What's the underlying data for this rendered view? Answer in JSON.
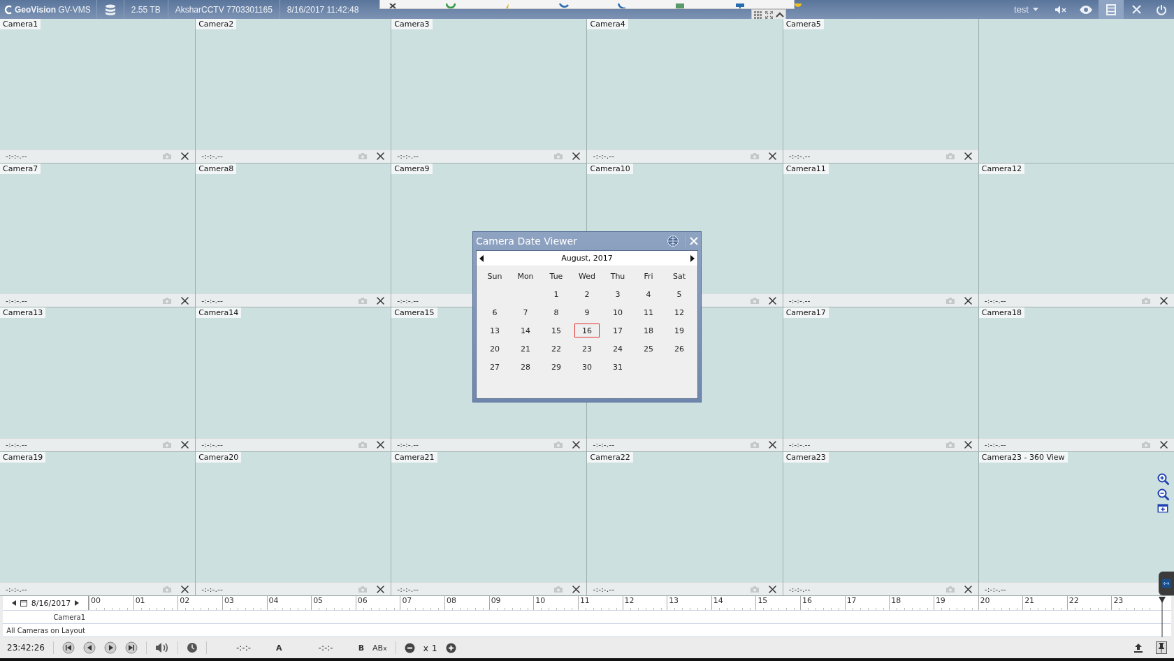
{
  "top_bar": {
    "logo": "GeoVision",
    "product": "GV-VMS",
    "storage": "2.55 TB",
    "server": "AksharCCTV 7703301165",
    "datetime": "8/16/2017 11:42:48",
    "user": "test"
  },
  "cells": [
    {
      "kind": "camera",
      "label": "Camera1",
      "time": "-:-:-.--"
    },
    {
      "kind": "camera",
      "label": "Camera2",
      "time": "-:-:-.--"
    },
    {
      "kind": "camera",
      "label": "Camera3",
      "time": "-:-:-.--"
    },
    {
      "kind": "camera",
      "label": "Camera4",
      "time": "-:-:-.--"
    },
    {
      "kind": "camera",
      "label": "Camera5",
      "time": "-:-:-.--"
    },
    {
      "kind": "empty"
    },
    {
      "kind": "camera",
      "label": "Camera7",
      "time": "-:-:-.--"
    },
    {
      "kind": "camera",
      "label": "Camera8",
      "time": "-:-:-.--"
    },
    {
      "kind": "covered",
      "label": "Camera9",
      "time": "-:-:-.--"
    },
    {
      "kind": "camera",
      "label": "Camera10"
    },
    {
      "kind": "camera",
      "label": "Camera11",
      "time": "-:-:-.--"
    },
    {
      "kind": "camera",
      "label": "Camera12",
      "time": "-:-:-.--"
    },
    {
      "kind": "camera",
      "label": "Camera13",
      "time": "-:-:-.--"
    },
    {
      "kind": "camera",
      "label": "Camera14",
      "time": "-:-:-.--"
    },
    {
      "kind": "camera",
      "label": "Camera15",
      "time": "-:-:-.--"
    },
    {
      "kind": "camera",
      "time": "-:-:-.--"
    },
    {
      "kind": "camera",
      "label": "Camera17",
      "time": "-:-:-.--"
    },
    {
      "kind": "camera",
      "label": "Camera18",
      "time": "-:-:-.--"
    },
    {
      "kind": "camera",
      "label": "Camera19",
      "time": "-:-:-.--"
    },
    {
      "kind": "camera",
      "label": "Camera20",
      "time": "-:-:-.--"
    },
    {
      "kind": "camera",
      "label": "Camera21",
      "time": "-:-:-.--"
    },
    {
      "kind": "camera",
      "label": "Camera22",
      "time": "-:-:-.--"
    },
    {
      "kind": "camera",
      "label": "Camera23",
      "time": "-:-:-.--"
    },
    {
      "kind": "panorama",
      "label": "Camera23 - 360 View",
      "time": "-:-:-.--"
    }
  ],
  "dialog": {
    "title": "Camera Date Viewer",
    "month": "August, 2017",
    "weekdays": [
      "Sun",
      "Mon",
      "Tue",
      "Wed",
      "Thu",
      "Fri",
      "Sat"
    ],
    "weeks": [
      [
        {
          "kind": "blank"
        },
        {
          "kind": "blank"
        },
        {
          "day": "1",
          "selected": false
        },
        {
          "day": "2",
          "selected": false
        },
        {
          "day": "3",
          "selected": false
        },
        {
          "day": "4",
          "selected": false
        },
        {
          "day": "5",
          "selected": false
        }
      ],
      [
        {
          "day": "6",
          "selected": false
        },
        {
          "day": "7",
          "selected": false
        },
        {
          "day": "8",
          "selected": false
        },
        {
          "day": "9",
          "selected": false
        },
        {
          "day": "10",
          "selected": false
        },
        {
          "day": "11",
          "selected": false
        },
        {
          "day": "12",
          "selected": false
        }
      ],
      [
        {
          "day": "13",
          "selected": false
        },
        {
          "day": "14",
          "selected": false
        },
        {
          "day": "15",
          "selected": false
        },
        {
          "day": "16",
          "selected": true
        },
        {
          "day": "17",
          "selected": false
        },
        {
          "day": "18",
          "selected": false
        },
        {
          "day": "19",
          "selected": false
        }
      ],
      [
        {
          "day": "20",
          "selected": false
        },
        {
          "day": "21",
          "selected": false
        },
        {
          "day": "22",
          "selected": false
        },
        {
          "day": "23",
          "selected": false
        },
        {
          "day": "24",
          "selected": false
        },
        {
          "day": "25",
          "selected": false
        },
        {
          "day": "26",
          "selected": false
        }
      ],
      [
        {
          "day": "27",
          "selected": false
        },
        {
          "day": "28",
          "selected": false
        },
        {
          "day": "29",
          "selected": false
        },
        {
          "day": "30",
          "selected": false
        },
        {
          "day": "31",
          "selected": false
        }
      ]
    ]
  },
  "timeline": {
    "date": "8/16/2017",
    "hours": [
      "00",
      "01",
      "02",
      "03",
      "04",
      "05",
      "06",
      "07",
      "08",
      "09",
      "10",
      "11",
      "12",
      "13",
      "14",
      "15",
      "16",
      "17",
      "18",
      "19",
      "20",
      "21",
      "22",
      "23"
    ],
    "rows": [
      "Camera1",
      "All Cameras on Layout"
    ]
  },
  "controls": {
    "clock": "23:42:26",
    "mark_a_time": "-:-:-",
    "mark_a": "A",
    "mark_b_time": "-:-:-",
    "mark_b": "B",
    "ab": "AB",
    "ab_sup": "x",
    "speed": "x 1"
  }
}
